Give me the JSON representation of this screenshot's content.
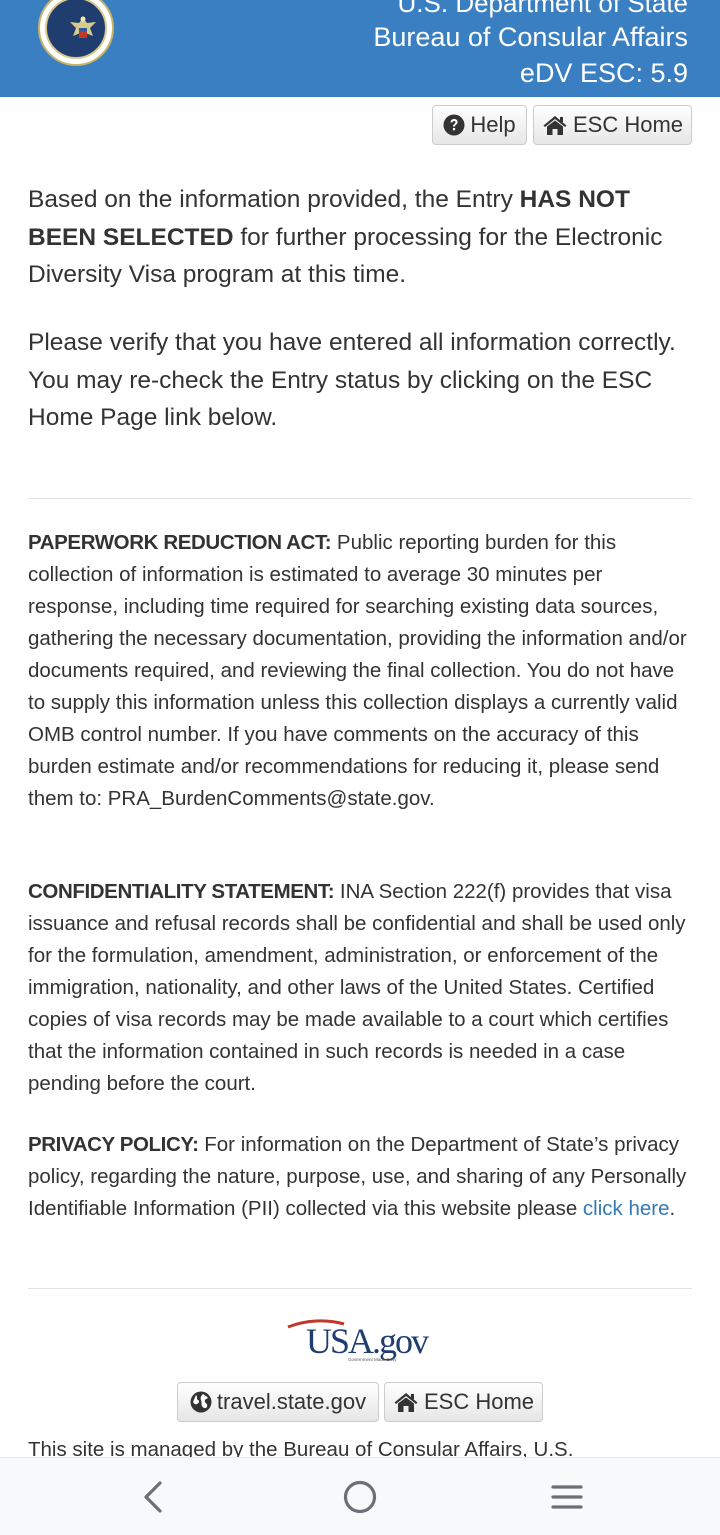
{
  "header": {
    "line1": "U.S. Department of State",
    "line2": "Bureau of Consular Affairs",
    "line3": "eDV ESC: 5.9",
    "seal_icon": "department-of-state-seal-icon"
  },
  "toolbar": {
    "help_label": "Help",
    "esc_home_label": "ESC Home"
  },
  "result": {
    "p1_before": "Based on the information provided, the Entry ",
    "p1_bold": "HAS NOT BEEN SELECTED",
    "p1_after": " for further processing for the Electronic Diversity Visa program at this time.",
    "p2": "Please verify that you have entered all information correctly. You may re-check the Entry status by clicking on the ESC Home Page link below."
  },
  "legal": {
    "pra_title": "PAPERWORK REDUCTION ACT:",
    "pra_text": " Public reporting burden for this collection of information is estimated to average 30 minutes per response, including time required for searching existing data sources, gathering the necessary documentation, providing the information and/or documents required, and reviewing the final collection. You do not have to supply this information unless this collection displays a currently valid OMB control number. If you have comments on the accuracy of this burden estimate and/or recommendations for reducing it, please send them to: PRA_BurdenComments@state.gov.",
    "conf_title": "CONFIDENTIALITY STATEMENT:",
    "conf_text": " INA Section 222(f) provides that visa issuance and refusal records shall be confidential and shall be used only for the formulation, amendment, administration, or enforcement of the immigration, nationality, and other laws of the United States. Certified copies of visa records may be made available to a court which certifies that the information contained in such records is needed in a case pending before the court.",
    "privacy_title": "PRIVACY POLICY:",
    "privacy_text": " For information on the Department of State’s privacy policy, regarding the nature, purpose, use, and sharing of any Personally Identifiable Information (PII) collected via this website please ",
    "privacy_link": "click here",
    "privacy_end": "."
  },
  "footer": {
    "usagov_text": "USA.gov",
    "usagov_tagline": "Government Made Easy",
    "travel_label": "travel.state.gov",
    "esc_home_label": "ESC Home",
    "managed_text": "This site is managed by the Bureau of Consular Affairs, U.S."
  },
  "colors": {
    "header_bg": "#3a7fc1",
    "link": "#337ab7",
    "text": "#333333"
  },
  "navbar": {
    "back_icon": "back-chevron-icon",
    "home_icon": "home-circle-icon",
    "menu_icon": "menu-lines-icon"
  }
}
